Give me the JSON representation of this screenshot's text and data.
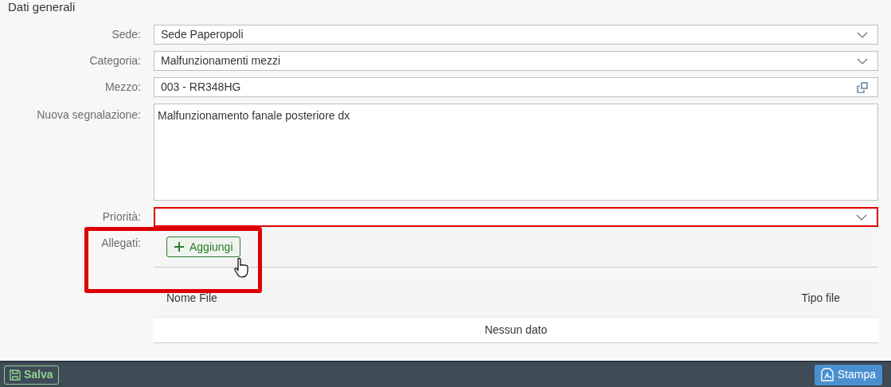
{
  "section_title": "Dati generali",
  "fields": [
    {
      "label": "Sede:",
      "kind": "select",
      "value": "Sede Paperopoli",
      "invalid": false
    },
    {
      "label": "Categoria:",
      "kind": "select",
      "value": "Malfunzionamenti mezzi",
      "invalid": false
    },
    {
      "label": "Mezzo:",
      "kind": "valuehelp",
      "value": "003 - RR348HG",
      "invalid": false
    },
    {
      "label": "Nuova segnalazione:",
      "kind": "textarea",
      "value": "Malfunzionamento fanale posteriore dx",
      "invalid": false
    },
    {
      "label": "Priorità:",
      "kind": "select",
      "invalid": true
    }
  ],
  "attachments": {
    "label": "Allegati:",
    "add_button": "Aggiungi",
    "columns": [
      "Nome File",
      "Tipo file"
    ],
    "empty_text": "Nessun dato"
  },
  "footer": {
    "save_button": "Salva",
    "print_button": "Stampa"
  }
}
